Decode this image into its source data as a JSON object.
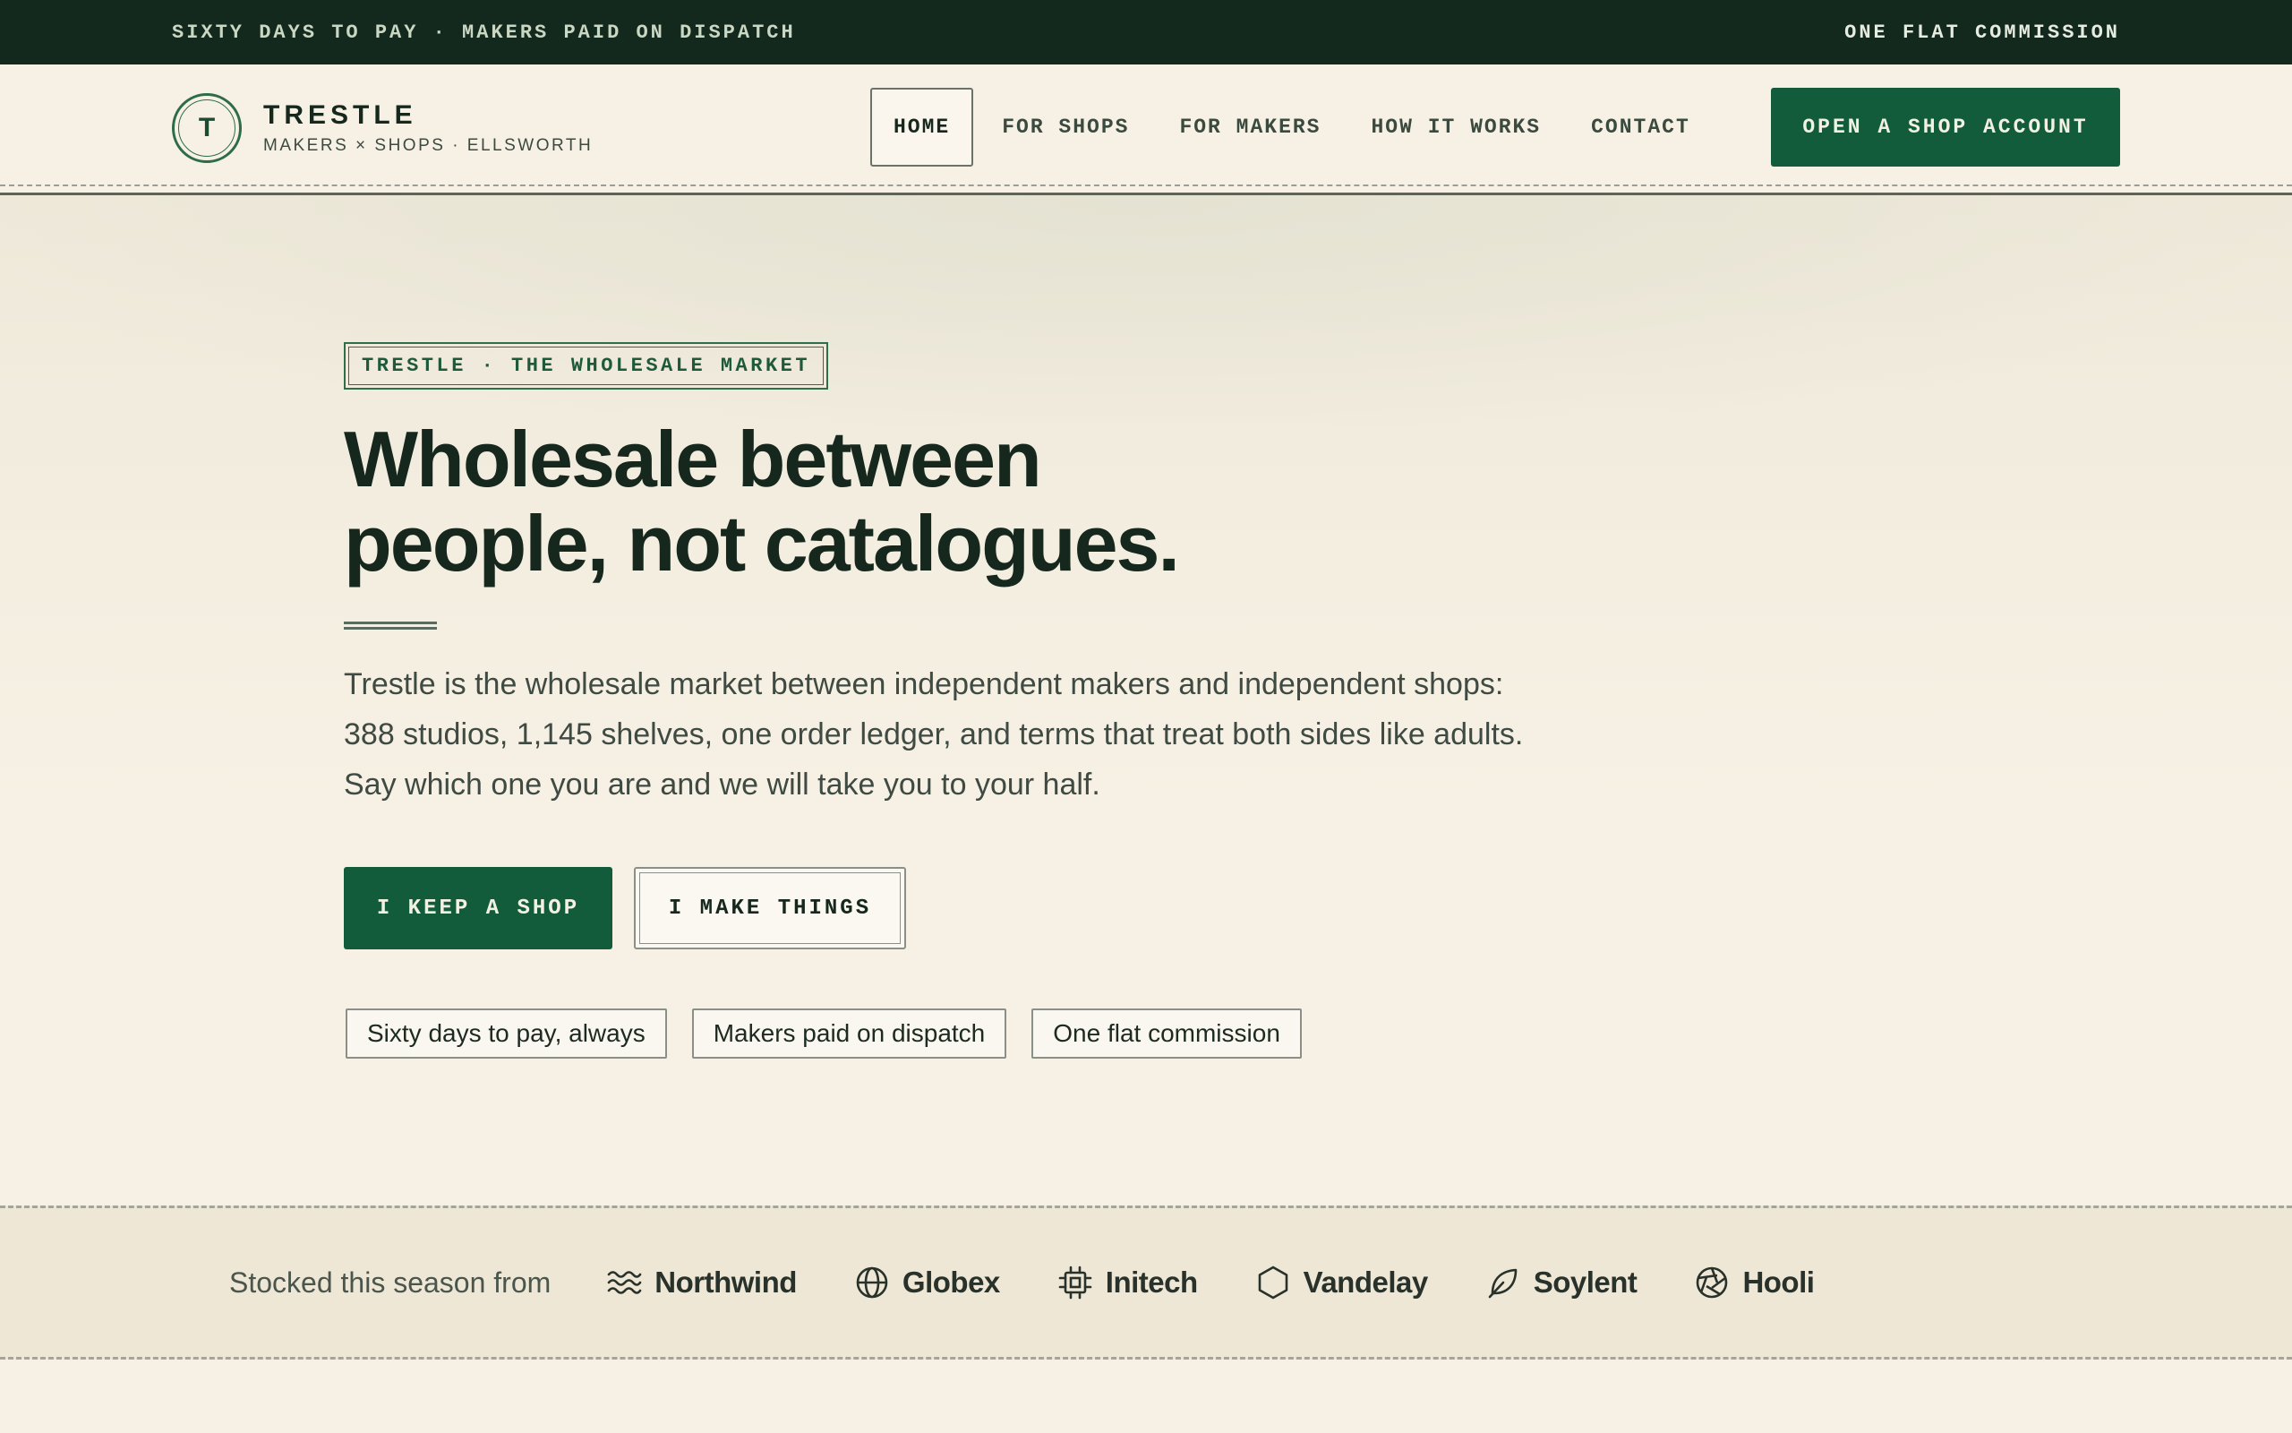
{
  "topbar": {
    "left": "SIXTY DAYS TO PAY · MAKERS PAID ON DISPATCH",
    "right": "ONE FLAT COMMISSION"
  },
  "brand": {
    "mark": "T",
    "name": "TRESTLE",
    "tagline": "MAKERS × SHOPS · ELLSWORTH"
  },
  "nav": {
    "items": [
      {
        "label": "HOME",
        "active": true
      },
      {
        "label": "FOR SHOPS"
      },
      {
        "label": "FOR MAKERS"
      },
      {
        "label": "HOW IT WORKS"
      },
      {
        "label": "CONTACT"
      }
    ],
    "cta": "OPEN A SHOP ACCOUNT"
  },
  "hero": {
    "eyebrow": "TRESTLE · THE WHOLESALE MARKET",
    "headline_line1": "Wholesale between",
    "headline_line2": "people, not catalogues.",
    "lede": "Trestle is the wholesale market between independent makers and independent shops: 388 studios, 1,145 shelves, one order ledger, and terms that treat both sides like adults. Say which one you are and we will take you to your half.",
    "primary_button": "I KEEP A SHOP",
    "secondary_button": "I MAKE THINGS",
    "pills": [
      "Sixty days to pay, always",
      "Makers paid on dispatch",
      "One flat commission"
    ]
  },
  "strip": {
    "label": "Stocked this season from",
    "logos": [
      {
        "name": "Northwind",
        "icon": "waves-icon"
      },
      {
        "name": "Globex",
        "icon": "globe-icon"
      },
      {
        "name": "Initech",
        "icon": "chip-icon"
      },
      {
        "name": "Vandelay",
        "icon": "hexagon-icon"
      },
      {
        "name": "Soylent",
        "icon": "leaf-icon"
      },
      {
        "name": "Hooli",
        "icon": "aperture-icon"
      }
    ]
  },
  "colors": {
    "background": "#f7f1e5",
    "dark": "#13291e",
    "accent": "#135c3b",
    "text": "#16281d"
  }
}
